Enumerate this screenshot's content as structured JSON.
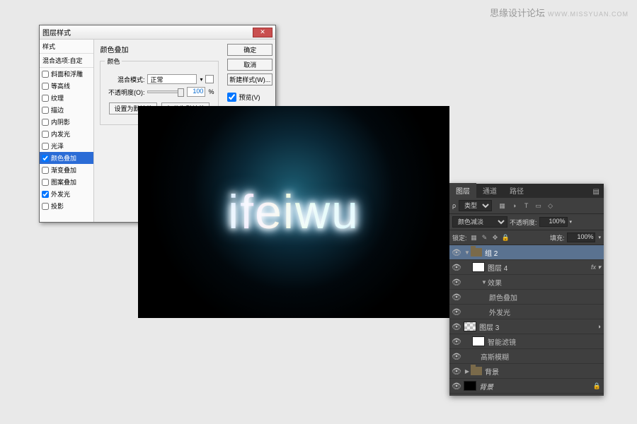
{
  "watermark": {
    "text": "思缘设计论坛",
    "sub": "WWW.MISSYUAN.COM"
  },
  "canvas": {
    "text": "ifeiwu"
  },
  "layer_style_dialog": {
    "title": "图层样式",
    "sidebar_head": "样式",
    "sidebar_sub": "混合选项:自定",
    "styles": [
      {
        "label": "斜面和浮雕",
        "checked": false
      },
      {
        "label": "等高线",
        "checked": false
      },
      {
        "label": "纹理",
        "checked": false
      },
      {
        "label": "描边",
        "checked": false
      },
      {
        "label": "内阴影",
        "checked": false
      },
      {
        "label": "内发光",
        "checked": false
      },
      {
        "label": "光泽",
        "checked": false
      },
      {
        "label": "颜色叠加",
        "checked": true,
        "selected": true
      },
      {
        "label": "渐变叠加",
        "checked": false
      },
      {
        "label": "图案叠加",
        "checked": false
      },
      {
        "label": "外发光",
        "checked": true
      },
      {
        "label": "投影",
        "checked": false
      }
    ],
    "section_title": "颜色叠加",
    "group_title": "颜色",
    "blend_label": "混合模式:",
    "blend_value": "正常",
    "opacity_label": "不透明度(O):",
    "opacity_value": "100",
    "opacity_unit": "%",
    "btn_default": "设置为默认值",
    "btn_reset": "复位为默认值",
    "buttons": {
      "ok": "确定",
      "cancel": "取消",
      "new_style": "新建样式(W)...",
      "preview": "预览(V)"
    }
  },
  "layers_panel": {
    "tabs": [
      "图层",
      "通道",
      "路径"
    ],
    "kind_label": "类型",
    "icons": [
      "▦",
      "◑",
      "T",
      "▭",
      "◇"
    ],
    "blend_mode": "颜色减淡",
    "opacity_label": "不透明度:",
    "opacity_value": "100%",
    "lock_label": "锁定:",
    "lock_icons": [
      "▦",
      "✎",
      "✥",
      "🔒"
    ],
    "fill_label": "填充:",
    "fill_value": "100%",
    "rows": [
      {
        "type": "group",
        "label": "组 2",
        "indent": 0,
        "eye": true,
        "arrow": "▼",
        "selected": true
      },
      {
        "type": "layer",
        "label": "图层 4",
        "indent": 1,
        "eye": true,
        "thumb": "white",
        "fx": "fx",
        "fxarrow": "▾"
      },
      {
        "type": "fx-label",
        "label": "效果",
        "indent": 2,
        "eye": true,
        "arrow": "▼"
      },
      {
        "type": "fx-item",
        "label": "颜色叠加",
        "indent": 3,
        "eye": true
      },
      {
        "type": "fx-item",
        "label": "外发光",
        "indent": 3,
        "eye": true
      },
      {
        "type": "layer",
        "label": "图层 3",
        "indent": 0,
        "eye": true,
        "thumb": "trans",
        "smarticon": true
      },
      {
        "type": "fx-label",
        "label": "智能滤镜",
        "indent": 1,
        "eye": true,
        "thumb": "white"
      },
      {
        "type": "fx-item",
        "label": "高斯模糊",
        "indent": 2,
        "eye": true
      },
      {
        "type": "group",
        "label": "背景",
        "indent": 0,
        "eye": true,
        "arrow": "▶"
      },
      {
        "type": "layer",
        "label": "背景",
        "indent": 0,
        "eye": true,
        "thumb": "black",
        "locked": true,
        "italic": true
      }
    ]
  }
}
